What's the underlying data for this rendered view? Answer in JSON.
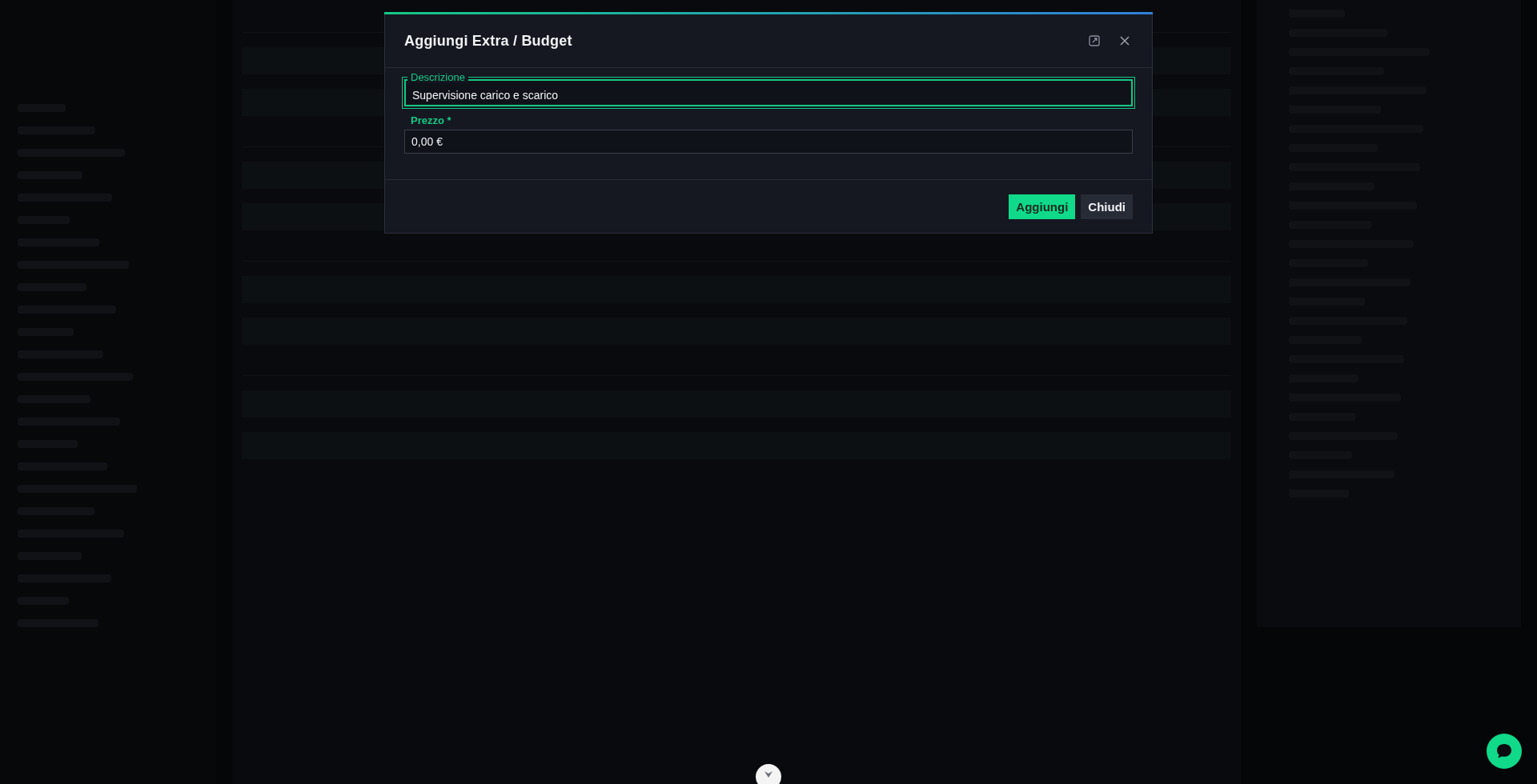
{
  "dialog": {
    "title": "Aggiungi Extra / Budget",
    "fields": [
      {
        "label": "Descrizione",
        "value": "Supervisione carico e scarico",
        "focused": true
      },
      {
        "label": "Prezzo *",
        "value": "0,00 €",
        "focused": false
      }
    ],
    "buttons": [
      {
        "label": "Aggiungi",
        "kind": "primary"
      },
      {
        "label": "Chiudi",
        "kind": "secondary"
      }
    ]
  }
}
